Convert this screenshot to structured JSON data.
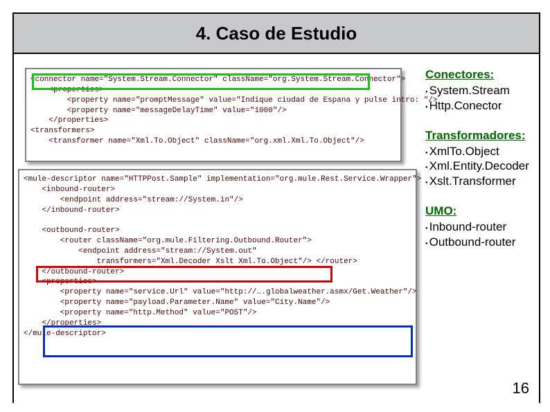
{
  "title": "4. Caso de Estudio",
  "slide_number": "16",
  "sidebar": {
    "conectores": {
      "heading": "Conectores:",
      "items": [
        "System.Stream",
        "Http.Conector"
      ]
    },
    "transformadores": {
      "heading": "Transformadores:",
      "items": [
        "XmlTo.Object",
        "Xml.Entity.Decoder",
        "Xslt.Transformer"
      ]
    },
    "umo": {
      "heading": "UMO:",
      "items": [
        "Inbound-router",
        "Outbound-router"
      ]
    }
  },
  "code_panel_a": "<connector name=\"System.Stream.Connector\" className=\"org.System.Stream.Connector\">\n    <properties>\n        <property name=\"promptMessage\" value=\"Indique ciudad de Espana y pulse intro: \"/>\n        <property name=\"messageDelayTime\" value=\"1000\"/>\n    </properties>\n<transformers>\n    <transformer name=\"Xml.To.Object\" className=\"org.xml.Xml.To.Object\"/>",
  "code_panel_b": "<mule-descriptor name=\"HTTPPost.Sample\" implementation=\"org.mule.Rest.Service.Wrapper\">\n    <inbound-router>\n        <endpoint address=\"stream://System.in\"/>\n    </inbound-router>\n\n    <outbound-router>\n        <router className=\"org.mule.Filtering.Outbound.Router\">\n            <endpoint address=\"stream://System.out\"\n                transformers=\"Xml.Decoder Xslt Xml.To.Object\"/> </router>\n    </outbound-router>\n    <properties>\n        <property name=\"service.Url\" value=\"http://….globalweather.asmx/Get.Weather\"/>\n        <property name=\"payload.Parameter.Name\" value=\"City.Name\"/>\n        <property name=\"http.Method\" value=\"POST\"/>\n    </properties>\n</mule-descriptor>"
}
